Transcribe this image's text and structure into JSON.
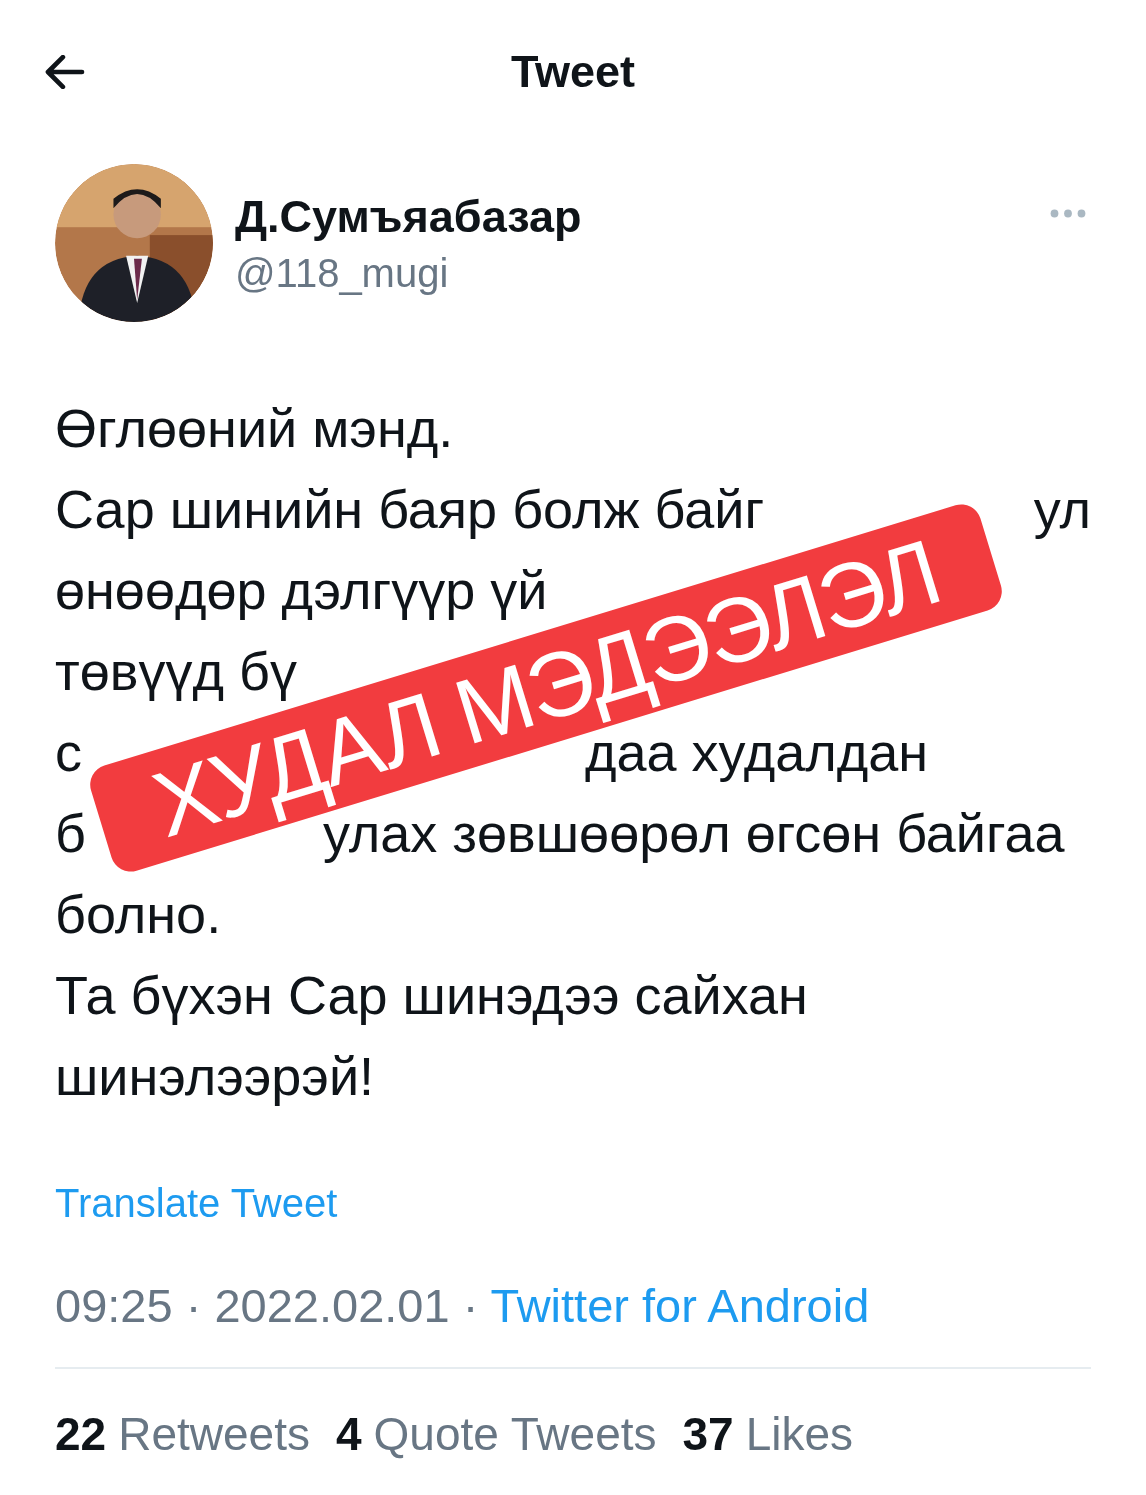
{
  "header": {
    "title": "Tweet"
  },
  "author": {
    "name": "Д.Сумъяабазар",
    "handle": "@118_mugi"
  },
  "tweet": {
    "lines": [
      {
        "parts": [
          "Өглөөний мэнд."
        ]
      },
      {
        "parts": [
          "Сар шинийн баяр болж байг",
          "ул"
        ]
      },
      {
        "parts": [
          "өнөөдөр дэлгүүр үй"
        ]
      },
      {
        "parts": [
          "төвүүд бү"
        ]
      },
      {
        "parts": [
          "с",
          "даа худалдан"
        ]
      },
      {
        "parts": [
          "б",
          "улах зөвшөөрөл өгсөн байгаа"
        ]
      },
      {
        "parts": [
          "болно."
        ]
      },
      {
        "parts": [
          "Та бүхэн Сар шинэдээ сайхан"
        ]
      },
      {
        "parts": [
          "шинэлээрэй!"
        ]
      }
    ],
    "stamp": "ХУДАЛ МЭДЭЭЛЭЛ"
  },
  "translate_link": "Translate Tweet",
  "meta": {
    "time": "09:25 · 2022.02.01 · ",
    "source": "Twitter for Android"
  },
  "stats": [
    {
      "count": "22",
      "label": "Retweets"
    },
    {
      "count": "4",
      "label": "Quote Tweets"
    },
    {
      "count": "37",
      "label": "Likes"
    }
  ]
}
